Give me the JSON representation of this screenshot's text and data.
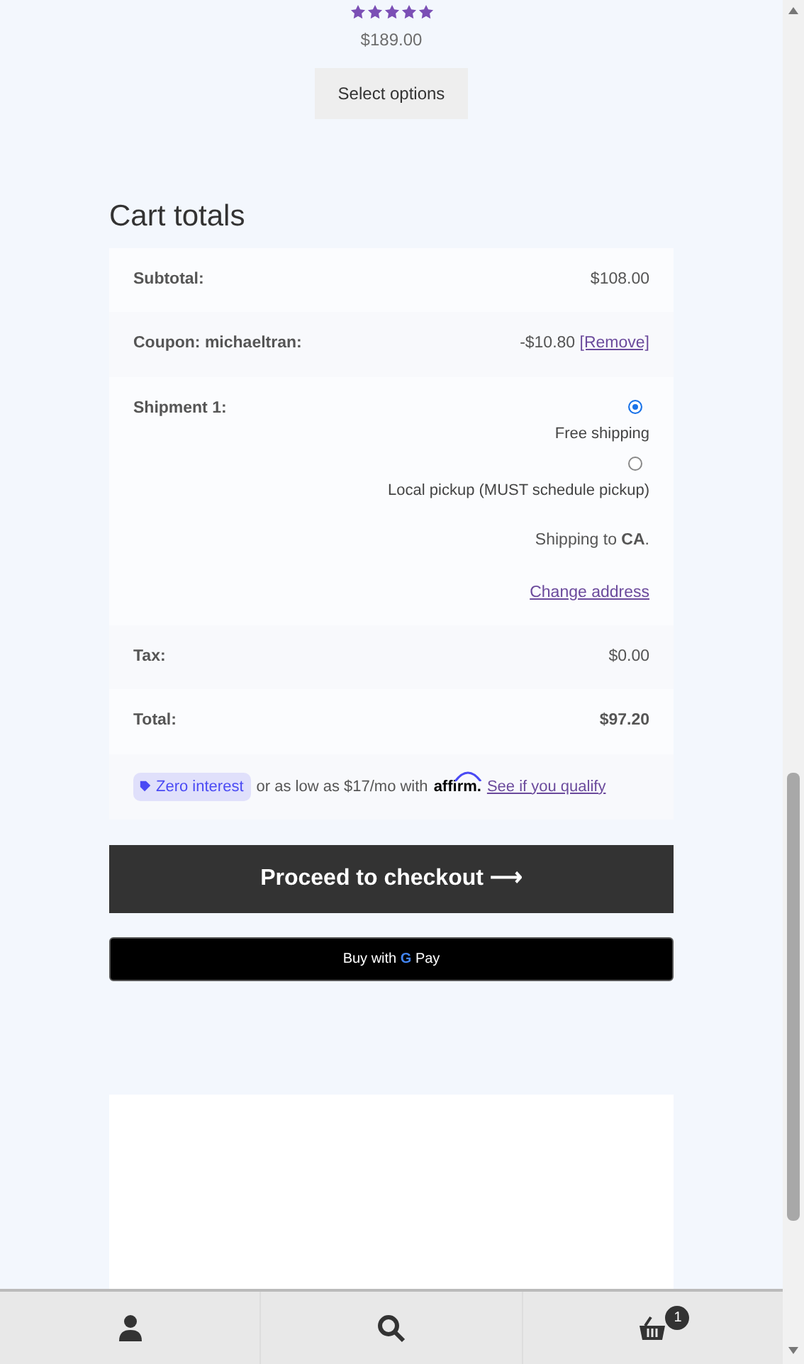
{
  "product": {
    "stars": 5,
    "price": "$189.00",
    "button": "Select options"
  },
  "cart_totals": {
    "title": "Cart totals",
    "rows": [
      {
        "kind": "line",
        "label": "Subtotal:",
        "value": "$108.00"
      },
      {
        "kind": "coupon",
        "label": "Coupon: michaeltran:",
        "value": "-$10.80",
        "link": "[Remove]"
      },
      {
        "kind": "shipping",
        "label": "Shipment 1:",
        "options": [
          {
            "label": "Free shipping",
            "selected": true
          },
          {
            "label": "Local pickup (MUST schedule pickup)",
            "selected": false
          }
        ],
        "destination_prefix": "Shipping to ",
        "destination": "CA",
        "destination_suffix": ".",
        "link": "Change address"
      },
      {
        "kind": "line",
        "label": "Tax:",
        "value": "$0.00"
      },
      {
        "kind": "total",
        "label": "Total:",
        "value": "$97.20"
      }
    ],
    "affirm": {
      "badge": "Zero interest",
      "text": "or as low as $17/mo with",
      "brand": "affirm",
      "dot": ".",
      "link": "See if you qualify"
    }
  },
  "checkout_button": "Proceed to checkout",
  "checkout_arrow": "⟶",
  "gpay_button": {
    "label": "Buy with",
    "brand_letter": "G",
    "brand_word": "Pay"
  },
  "bottom_nav": [
    {
      "kind": "account"
    },
    {
      "kind": "search"
    },
    {
      "kind": "cart",
      "count": "1"
    }
  ]
}
